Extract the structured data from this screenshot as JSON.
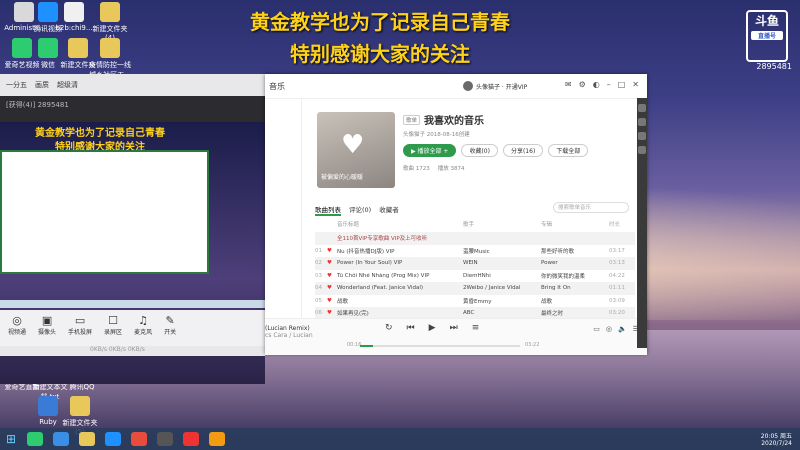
{
  "banner": {
    "line1": "黄金教学也为了记录自己青春",
    "line2": "特别感谢大家的关注"
  },
  "watermark": {
    "logo": "斗鱼",
    "tag": "直播号",
    "room": "2895481"
  },
  "desktop_icons": [
    {
      "label": "Administr...",
      "color": "#d9d9d9"
    },
    {
      "label": "腾讯视频",
      "color": "#1e90ff"
    },
    {
      "label": "b2b:chi9...",
      "color": "#f0f0f0"
    },
    {
      "label": "新建文件夹(4)",
      "color": "#e8c85a"
    },
    {
      "label": "爱奇艺视频",
      "color": "#2ecc71"
    },
    {
      "label": "微信",
      "color": "#2ecc71"
    },
    {
      "label": "新建文件夹",
      "color": "#e8c85a"
    },
    {
      "label": "疫情防控一线城乡社区工...",
      "color": "#e8c85a"
    },
    {
      "label": "爱奇艺直播",
      "color": "#2ecc71"
    },
    {
      "label": "新建文本文档.txt",
      "color": "#f5f5f5"
    },
    {
      "label": "腾讯QQ",
      "color": "#222"
    },
    {
      "label": "Ruby",
      "color": "#3a7bd5"
    },
    {
      "label": "新建文件夹(5)",
      "color": "#e8c85a"
    }
  ],
  "stream_ctl": {
    "tabs": [
      "一分五",
      "画质",
      "超级清"
    ],
    "counts": "[获得(4)]  2895481",
    "preview_line1": "黄金教学也为了记录自己青春",
    "preview_line2": "特别感谢大家的关注",
    "tools": [
      {
        "icon": "◎",
        "label": "视频通"
      },
      {
        "icon": "▣",
        "label": "摄像头"
      },
      {
        "icon": "▭",
        "label": "手机投屏"
      },
      {
        "icon": "☐",
        "label": "录屏区"
      },
      {
        "icon": "♫",
        "label": "麦克风"
      },
      {
        "icon": "✎",
        "label": "开关"
      }
    ],
    "status": "0KB/s   0KB/s   0KB/s"
  },
  "app": {
    "header_title": "音乐",
    "account": "头像猫子 ·  开通VIP",
    "playlist": {
      "badge": "歌单",
      "title": "我喜欢的音乐",
      "cover_text": "被偏爱的心暖暖",
      "meta": "头像猫子  2018-08-16创建",
      "stats": [
        {
          "label": "歌曲",
          "value": "1723"
        },
        {
          "label": "播放",
          "value": "3874"
        }
      ],
      "buttons": [
        "▶ 播放全部 +",
        "收藏(0)",
        "分享(16)",
        "下载全部"
      ]
    },
    "tabs": [
      "歌曲列表",
      "评论(0)",
      "收藏者"
    ],
    "search_placeholder": "搜索歌单音乐",
    "columns": [
      "音乐标题",
      "歌手",
      "专辑",
      "时长"
    ],
    "rows": [
      {
        "n": "",
        "title": "全110首VIP专享歌曲    VIP及上可收听",
        "artist": "",
        "album": "",
        "dur": ""
      },
      {
        "n": "01",
        "title": "Nu (抖音热播DJ版) VIP",
        "artist": "蛮腰Music",
        "album": "那些好听的歌",
        "dur": "03:17"
      },
      {
        "n": "02",
        "title": "Power (In Your Soul) VIP",
        "artist": "WEIN",
        "album": "Power",
        "dur": "03:13"
      },
      {
        "n": "03",
        "title": "Tú Chôi Nhé Nhàng (Prog Mix) VIP",
        "artist": "DiemHNhi",
        "album": "你的微笑我的温柔",
        "dur": "04:22"
      },
      {
        "n": "04",
        "title": "Wonderland (Feat. Janice Vidal)",
        "artist": "2Weibo / Janice Vidal",
        "album": "Bring It On",
        "dur": "01:11"
      },
      {
        "n": "05",
        "title": "战歌",
        "artist": "黄昏Emmy",
        "album": "战歌",
        "dur": "03:09"
      },
      {
        "n": "06",
        "title": "如果再见(完)",
        "artist": "ABC",
        "album": "最终之时",
        "dur": "03:20"
      }
    ],
    "now_playing": {
      "title": "(Lucian Remix)",
      "artist": "cs Cara / Lucian",
      "elapsed": "00:16",
      "total": "03:22",
      "progress": 0.08
    }
  },
  "taskbar": {
    "time": "20:05 周五",
    "date": "2020/7/24"
  }
}
